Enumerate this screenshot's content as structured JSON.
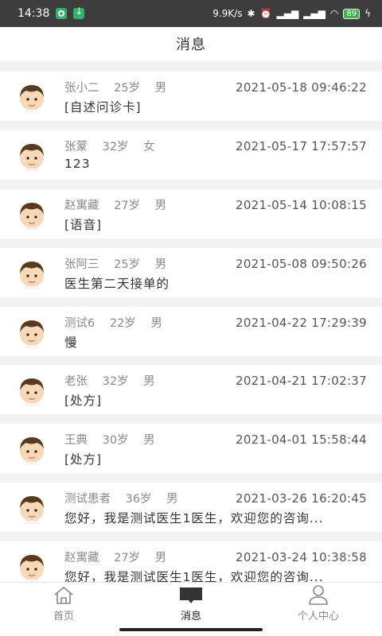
{
  "status_bar": {
    "time": "14:38",
    "net_speed": "9.9K/s",
    "battery": "89"
  },
  "header": {
    "title": "消息"
  },
  "messages": [
    {
      "name": "张小二",
      "age": "25岁",
      "gender": "男",
      "time": "2021-05-18 09:46:22",
      "preview": "[自述问诊卡]"
    },
    {
      "name": "张蒙",
      "age": "32岁",
      "gender": "女",
      "time": "2021-05-17 17:57:57",
      "preview": "123"
    },
    {
      "name": "赵寓藏",
      "age": "27岁",
      "gender": "男",
      "time": "2021-05-14 10:08:15",
      "preview": "[语音]"
    },
    {
      "name": "张阿三",
      "age": "25岁",
      "gender": "男",
      "time": "2021-05-08 09:50:26",
      "preview": "医生第二天接单的"
    },
    {
      "name": "测试6",
      "age": "22岁",
      "gender": "男",
      "time": "2021-04-22 17:29:39",
      "preview": "慢"
    },
    {
      "name": "老张",
      "age": "32岁",
      "gender": "男",
      "time": "2021-04-21 17:02:37",
      "preview": "[处方]"
    },
    {
      "name": "王典",
      "age": "30岁",
      "gender": "男",
      "time": "2021-04-01 15:58:44",
      "preview": "[处方]"
    },
    {
      "name": "测试患者",
      "age": "36岁",
      "gender": "男",
      "time": "2021-03-26 16:20:45",
      "preview": "您好，我是测试医生1医生，欢迎您的咨询..."
    },
    {
      "name": "赵寓藏",
      "age": "27岁",
      "gender": "男",
      "time": "2021-03-24 10:38:58",
      "preview": "您好，我是测试医生1医生，欢迎您的咨询..."
    }
  ],
  "tabs": [
    {
      "label": "首页",
      "icon": "home-icon"
    },
    {
      "label": "消息",
      "icon": "message-icon"
    },
    {
      "label": "个人中心",
      "icon": "user-icon"
    }
  ]
}
